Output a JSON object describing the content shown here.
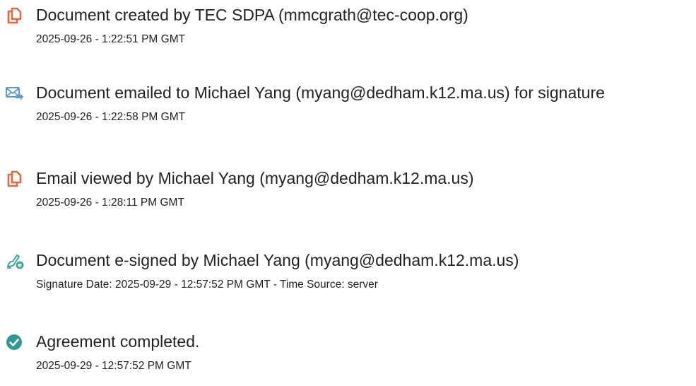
{
  "events": [
    {
      "icon": "document-created-icon",
      "title": "Document created by TEC SDPA (mmcgrath@tec-coop.org)",
      "meta": "2025-09-26 - 1:22:51 PM GMT"
    },
    {
      "icon": "email-sent-icon",
      "title": "Document emailed to Michael Yang (myang@dedham.k12.ma.us) for signature",
      "meta": "2025-09-26 - 1:22:58 PM GMT"
    },
    {
      "icon": "email-viewed-icon",
      "title": "Email viewed by Michael Yang (myang@dedham.k12.ma.us)",
      "meta": "2025-09-26 - 1:28:11 PM GMT"
    },
    {
      "icon": "e-signed-pen-icon",
      "title": "Document e-signed by Michael Yang (myang@dedham.k12.ma.us)",
      "meta": "Signature Date: 2025-09-29 - 12:57:52 PM GMT - Time Source: server"
    },
    {
      "icon": "completed-check-icon",
      "title": "Agreement completed.",
      "meta": "2025-09-29 - 12:57:52 PM GMT"
    }
  ],
  "colors": {
    "document_icon": "#E8643C",
    "email_icon": "#5B9BD5",
    "email_arrow": "#E8643C",
    "pen_icon": "#3FA69B",
    "check_icon": "#2E9A8F",
    "text": "#222222"
  }
}
